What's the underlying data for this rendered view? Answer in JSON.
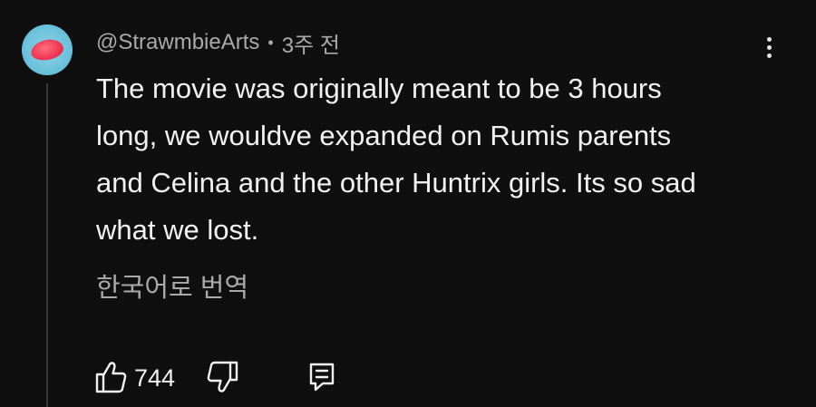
{
  "comment": {
    "author": "@StrawmbieArts",
    "separator": "•",
    "time_ago": "3주 전",
    "text": "The movie was originally meant to be 3 hours\nlong, we wouldve expanded on Rumis parents\nand Celina and the other Huntrix girls. Its so sad\nwhat we lost.",
    "translate_label": "한국어로 번역",
    "like_count": "744"
  },
  "icons": {
    "avatar": "avatar-image",
    "more": "more-vertical-icon",
    "like": "thumbs-up-icon",
    "dislike": "thumbs-down-icon",
    "reply": "reply-comment-icon"
  },
  "colors": {
    "background": "#0f0f0f",
    "primary_text": "#f1f1f1",
    "secondary_text": "#aaaaaa"
  }
}
